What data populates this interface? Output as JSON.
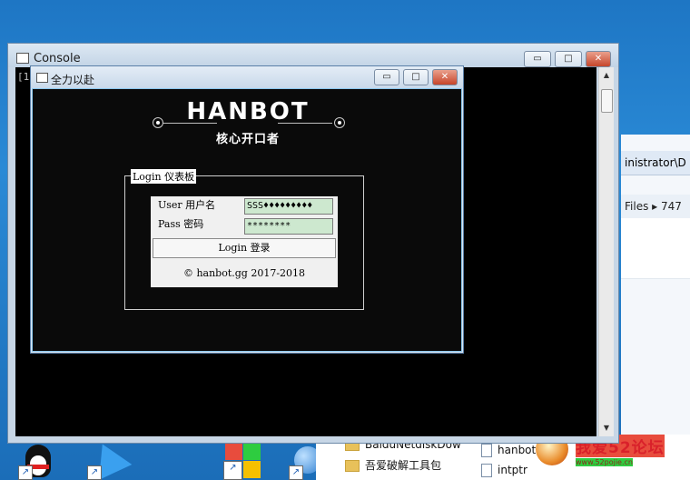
{
  "console": {
    "title": "Console",
    "prompt": "[1"
  },
  "login_window": {
    "title": "全力以赴",
    "brand_title": "HANBOT",
    "brand_subtitle": "核心开口者",
    "group_label": "Login 仪表板",
    "user_label": "User 用户名",
    "user_value": "SSS♦♦♦♦♦♦♦♦♦",
    "pass_label": "Pass 密码",
    "pass_value": "********",
    "login_button": "Login 登录",
    "copyright": "© hanbot.gg 2017-2018"
  },
  "window_buttons": {
    "minimize": "▭",
    "maximize": "□",
    "close": "✕"
  },
  "explorer": {
    "address_text": "inistrator\\D",
    "crumb_text": "Files ▸ 747"
  },
  "files": {
    "items": [
      {
        "name": "BaiduNetdiskDow",
        "icon": "folder-icon"
      },
      {
        "name": "吾爱破解工具包",
        "icon": "folder-icon"
      },
      {
        "name": "hanbot.dat",
        "icon": "file-icon"
      },
      {
        "name": "intptr",
        "icon": "file-icon"
      }
    ]
  },
  "watermark": {
    "text": "我爱52论坛",
    "url": "www.52pojie.cn"
  }
}
